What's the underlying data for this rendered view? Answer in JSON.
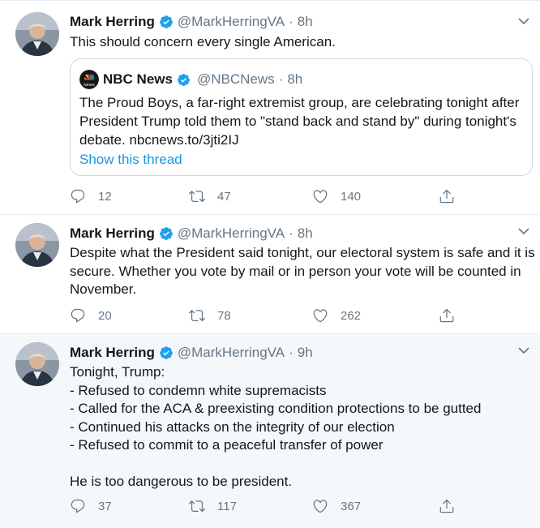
{
  "tweets": [
    {
      "author_name": "Mark Herring",
      "handle": "@MarkHerringVA",
      "separator": "·",
      "time": "8h",
      "lines": [
        "This should concern every single American."
      ],
      "quote": {
        "author_name": "NBC News",
        "handle": "@NBCNews",
        "separator": "·",
        "time": "8h",
        "lines": [
          "The Proud Boys, a far-right extremist group, are celebrating tonight after",
          "President Trump told them to \"stand back and stand by\" during tonight's",
          "debate. nbcnews.to/3jti2IJ"
        ],
        "link_label": "Show this thread"
      },
      "replies": "12",
      "retweets": "47",
      "likes": "140"
    },
    {
      "author_name": "Mark Herring",
      "handle": "@MarkHerringVA",
      "separator": "·",
      "time": "8h",
      "lines": [
        "Despite what the President said tonight, our electoral system is safe and it is",
        "secure. Whether you vote by mail or in person your vote will be counted in",
        "November."
      ],
      "replies": "20",
      "retweets": "78",
      "likes": "262"
    },
    {
      "author_name": "Mark Herring",
      "handle": "@MarkHerringVA",
      "separator": "·",
      "time": "9h",
      "lines": [
        "Tonight, Trump:",
        "- Refused to condemn white supremacists",
        "- Called for the ACA & preexisting condition protections to be gutted",
        "- Continued his attacks on the integrity of our election",
        "- Refused to commit to a peaceful transfer of power"
      ],
      "closing_line": "He is too dangerous to be president.",
      "replies": "37",
      "retweets": "117",
      "likes": "367"
    }
  ],
  "colors": {
    "accent": "#1da1f2",
    "muted": "#657786",
    "text": "#14171a",
    "border": "#e6ecf0",
    "hover_bg": "#f5f8fa"
  },
  "icons": {
    "reply": "reply-icon",
    "retweet": "retweet-icon",
    "like": "like-icon",
    "share": "share-icon",
    "verified": "verified-badge-icon",
    "more": "chevron-down-icon"
  }
}
